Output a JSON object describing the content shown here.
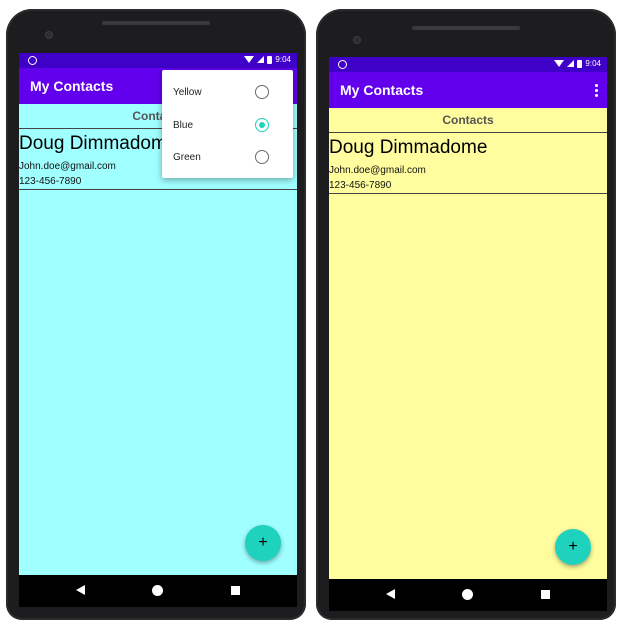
{
  "screens": [
    {
      "status": {
        "time": "9:04"
      },
      "app_title": "My Contacts",
      "contacts_header": "Contacts",
      "contact": {
        "name": "Doug Dimmadome",
        "email": "John.doe@gmail.com",
        "phone": "123-456-7890"
      },
      "fab_label": "+",
      "background_color": "#a0ffff",
      "color_menu": {
        "options": [
          {
            "label": "Yellow",
            "selected": false
          },
          {
            "label": "Blue",
            "selected": true
          },
          {
            "label": "Green",
            "selected": false
          }
        ]
      }
    },
    {
      "status": {
        "time": "9:04"
      },
      "app_title": "My Contacts",
      "contacts_header": "Contacts",
      "contact": {
        "name": "Doug Dimmadome",
        "email": "John.doe@gmail.com",
        "phone": "123-456-7890"
      },
      "fab_label": "+",
      "background_color": "#fffd9e"
    }
  ],
  "icons": [
    "wifi-icon",
    "signal-icon",
    "battery-icon",
    "overflow-menu-icon",
    "back-icon",
    "home-icon",
    "recents-icon",
    "add-icon"
  ],
  "colors": {
    "status_bar": "#3f00c8",
    "app_bar": "#6200ee",
    "fab": "#1ed2be",
    "radio_checked": "#1ed2be"
  }
}
